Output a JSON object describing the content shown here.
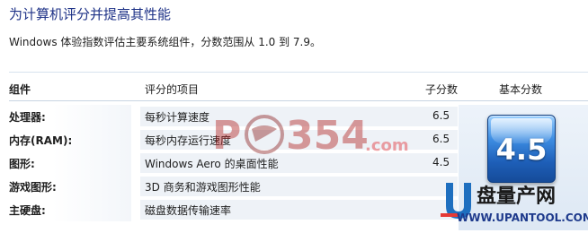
{
  "page": {
    "title": "为计算机评分并提高其性能",
    "subtitle": "Windows 体验指数评估主要系统组件，分数范围从 1.0 到 7.9。"
  },
  "table": {
    "headers": {
      "component": "组件",
      "item": "评分的项目",
      "subscore": "子分数",
      "base_score": "基本分数"
    },
    "rows": [
      {
        "component": "处理器:",
        "item": "每秒计算速度",
        "score": "6.5"
      },
      {
        "component": "内存(RAM):",
        "item": "每秒内存运行速度",
        "score": "6.5"
      },
      {
        "component": "图形:",
        "item": "Windows Aero 的桌面性能",
        "score": "4.5"
      },
      {
        "component": "游戏图形:",
        "item": "3D 商务和游戏图形性能",
        "score": ""
      },
      {
        "component": "主硬盘:",
        "item": "磁盘数据传输速率",
        "score": ""
      }
    ],
    "base_score": "4.5"
  },
  "watermarks": {
    "pc354_logo_text": "PC354.com",
    "upantool_logo_text": "U盘量产网",
    "upantool_url": "WWW.UPANTOOL.COM"
  }
}
